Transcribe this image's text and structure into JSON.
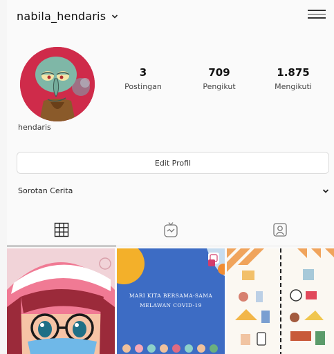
{
  "header": {
    "username": "nabila_hendaris"
  },
  "profile": {
    "display_name": "hendaris",
    "stats": [
      {
        "value": "3",
        "label": "Postingan"
      },
      {
        "value": "709",
        "label": "Pengikut"
      },
      {
        "value": "1.875",
        "label": "Mengikuti"
      }
    ]
  },
  "actions": {
    "edit_profile_label": "Edit Profil"
  },
  "highlights": {
    "title": "Sorotan Cerita"
  },
  "tabs": [
    {
      "icon": "grid-icon",
      "active": true
    },
    {
      "icon": "igtv-icon",
      "active": false
    },
    {
      "icon": "tagged-icon",
      "active": false
    }
  ],
  "posts": [
    {
      "icon": "anime-girl-post"
    },
    {
      "line1": "MARI KITA BERSAMA-SAMA",
      "line2": "MELAWAN COVID-19"
    },
    {
      "icon": "covid-infographic-post"
    }
  ],
  "colors": {
    "avatar_bg": "#cf2b4a",
    "post2_bg": "#3d6cc4"
  }
}
